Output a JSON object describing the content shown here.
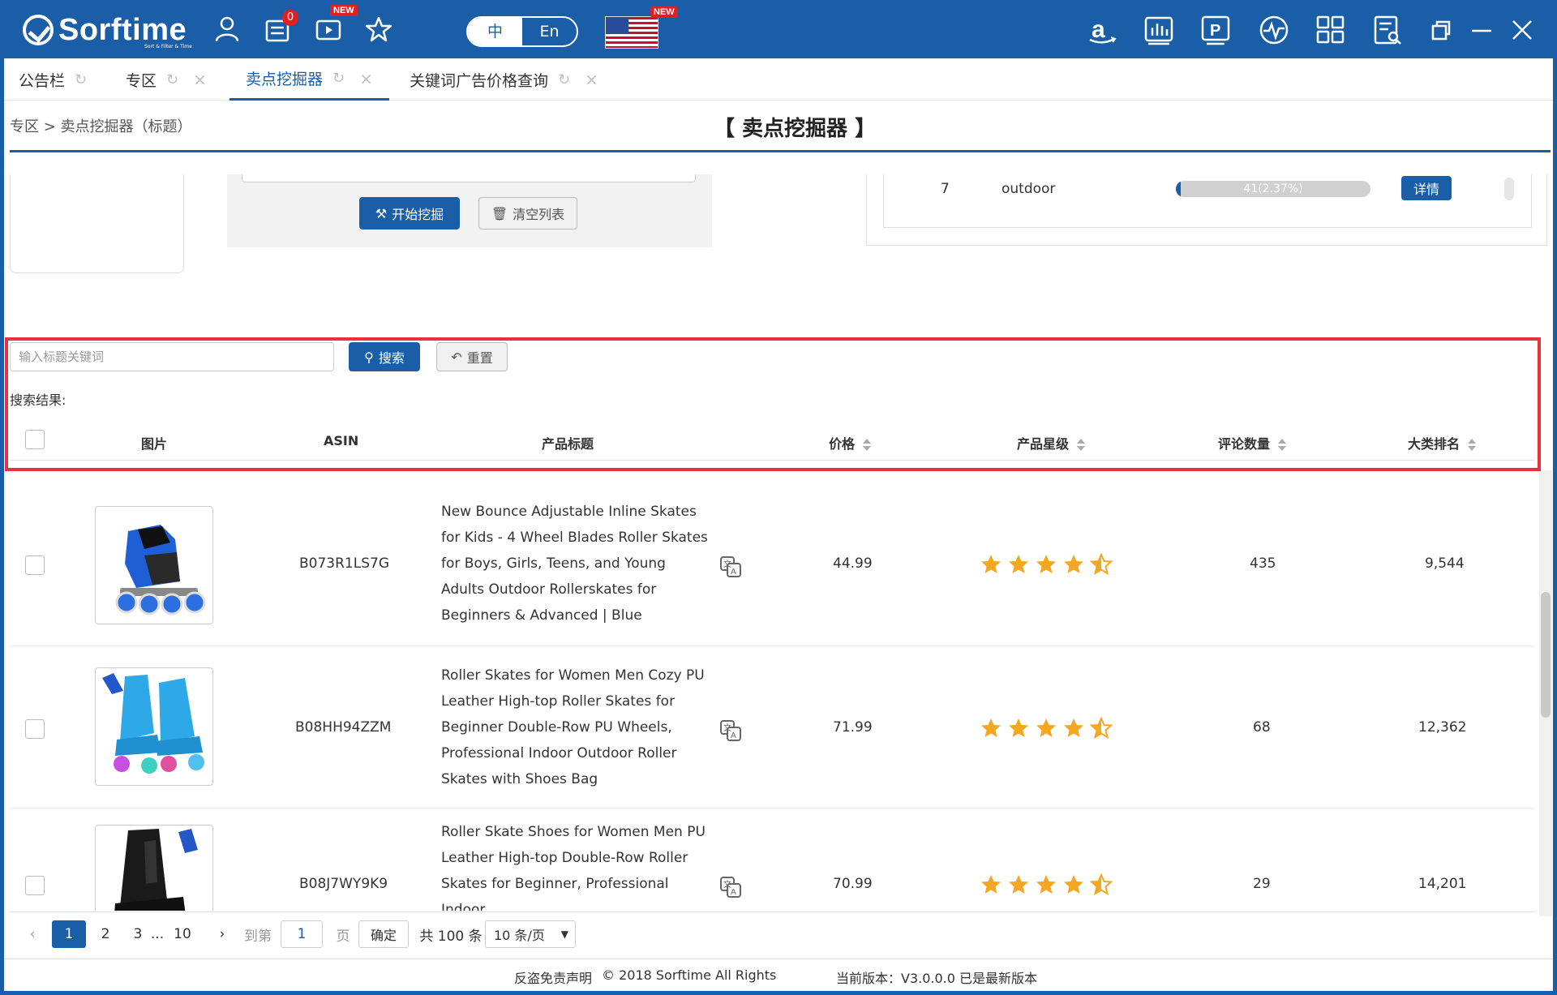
{
  "app": {
    "brand": "Sorftime",
    "brand_sub": "Sort & Filter & Time",
    "notif_count": "0",
    "new_badge": "NEW",
    "lang_cn": "中",
    "lang_en": "En"
  },
  "tabs": [
    {
      "label": "公告栏"
    },
    {
      "label": "专区"
    },
    {
      "label": "卖点挖掘器"
    },
    {
      "label": "关键词广告价格查询"
    }
  ],
  "breadcrumb": "专区 > 卖点挖掘器（标题）",
  "page_title": "【 卖点挖掘器 】",
  "miner": {
    "start_label": "开始挖掘",
    "clear_label": "清空列表"
  },
  "keyword_row": {
    "rank": "7",
    "word": "outdoor",
    "bar_text": "41(2.37%)",
    "bar_fraction": 0.0237,
    "detail_label": "详情"
  },
  "search": {
    "placeholder": "输入标题关键词",
    "search_label": "搜索",
    "reset_label": "重置",
    "results_label": "搜索结果:"
  },
  "table": {
    "headers": {
      "image": "图片",
      "asin": "ASIN",
      "title": "产品标题",
      "price": "价格",
      "rating": "产品星级",
      "reviews": "评论数量",
      "rank": "大类排名"
    },
    "rows": [
      {
        "asin": "B073R1LS7G",
        "title": "New Bounce Adjustable Inline Skates for Kids - 4 Wheel Blades Roller Skates for Boys, Girls, Teens, and Young Adults Outdoor Rollerskates for Beginners & Advanced | Blue",
        "price": "44.99",
        "rating": 4.5,
        "reviews": "435",
        "rank": "9,544"
      },
      {
        "asin": "B08HH94ZZM",
        "title": "Roller Skates for Women Men Cozy PU Leather High-top Roller Skates for Beginner Double-Row PU Wheels, Professional Indoor Outdoor Roller Skates with Shoes Bag",
        "price": "71.99",
        "rating": 4.5,
        "reviews": "68",
        "rank": "12,362"
      },
      {
        "asin": "B08J7WY9K9",
        "title": "Roller Skate Shoes for Women Men PU Leather High-top Double-Row Roller Skates for Beginner, Professional Indoor",
        "price": "70.99",
        "rating": 4.5,
        "reviews": "29",
        "rank": "14,201"
      }
    ]
  },
  "pager": {
    "p1": "1",
    "p2": "2",
    "p3": "3",
    "ellipsis": "...",
    "p10": "10",
    "goto_label": "到第",
    "goto_value": "1",
    "page_unit": "页",
    "confirm_label": "确定",
    "total_label": "共 100 条",
    "per_page": "10 条/页"
  },
  "footer": {
    "disclaimer": "反盗免责声明",
    "copyright": "© 2018 Sorftime All Rights",
    "version": "当前版本：V3.0.0.0  已是最新版本"
  },
  "colors": {
    "brand": "#1a5ea8",
    "highlight": "#e8313a",
    "star": "#f5a623"
  }
}
